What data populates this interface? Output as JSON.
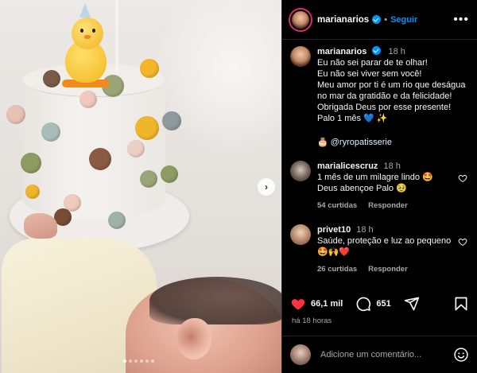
{
  "post": {
    "username": "marianarios",
    "follow_label": "Seguir",
    "more_label": "•••",
    "caption": {
      "time": "18 h",
      "text": "Eu não sei parar de te olhar!\nEu não sei viver sem você!\nMeu amor por ti é um rio que deságua no mar da gratidão e da felicidade!\nObrigada Deus por esse presente!\nPalo 1 mês 💙 ✨",
      "cake_emoji": "🎂",
      "mention": "@ryropatisserie"
    },
    "comments": [
      {
        "username": "marialicescruz",
        "time": "18 h",
        "text": "1 mês de um milagre lindo 🤩\nDeus abençoe Palo 🥹",
        "likes": "54 curtidas",
        "reply_label": "Responder"
      },
      {
        "username": "privet10",
        "time": "18 h",
        "text": "Saúde, proteção e luz ao pequeno\n🤩🙌❤️",
        "likes": "26 curtidas",
        "reply_label": "Responder"
      }
    ],
    "likes_count": "66,1 mil",
    "comments_count": "651",
    "posted_ago": "há 18 horas",
    "comment_placeholder": "Adicione um comentário..."
  },
  "icons": {
    "like": "heart-icon",
    "comment": "comment-icon",
    "share": "share-icon",
    "save": "bookmark-icon",
    "emoji": "emoji-icon",
    "next": "chevron-right-icon"
  },
  "colors": {
    "background": "#000000",
    "text": "#f5f5f5",
    "muted": "#a8a8a8",
    "accent_blue": "#0095f6",
    "like_red": "#ff3040"
  },
  "carousel": {
    "total": 6,
    "active": 1
  }
}
